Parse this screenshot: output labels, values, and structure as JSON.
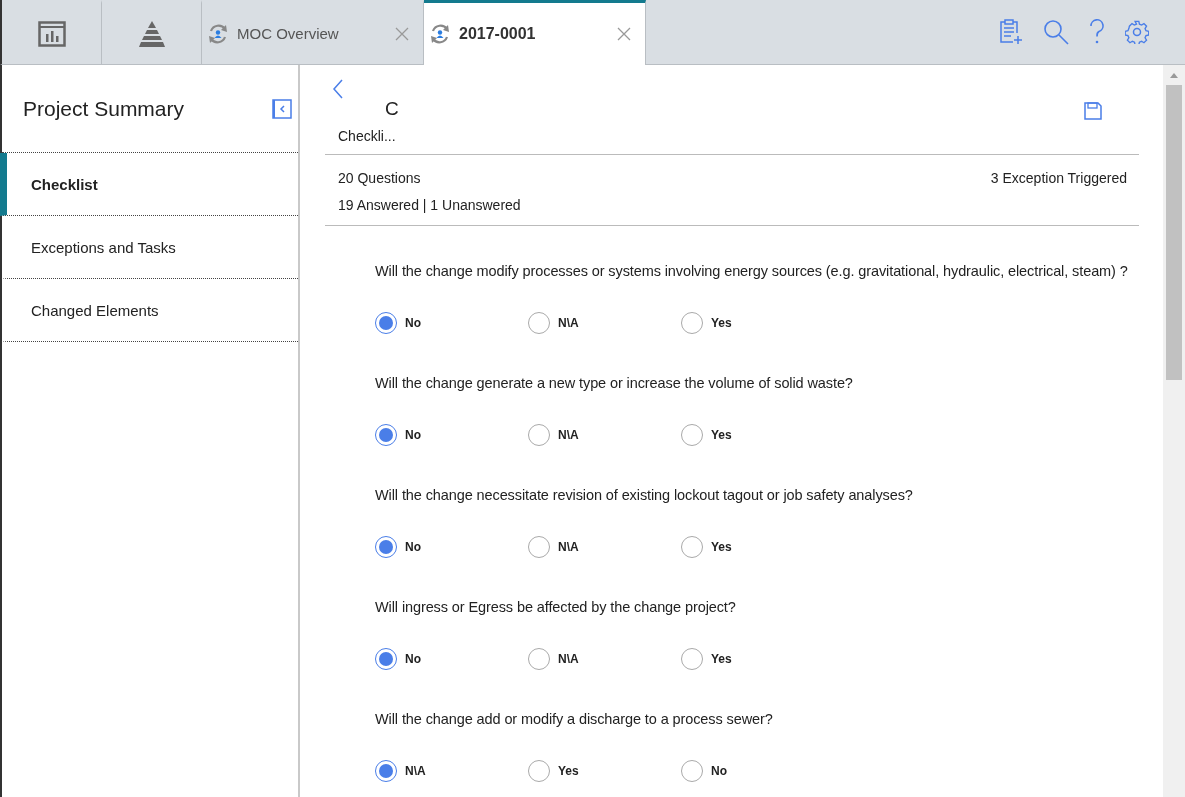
{
  "tabs": [
    {
      "kind": "report",
      "selected": false
    },
    {
      "kind": "pyramid",
      "selected": false
    },
    {
      "kind": "document",
      "label": "MOC Overview",
      "selected": false
    },
    {
      "kind": "document",
      "label": "2017-0001",
      "selected": true
    }
  ],
  "sidebar": {
    "title": "Project Summary",
    "items": [
      {
        "label": "Checklist",
        "selected": true
      },
      {
        "label": "Exceptions and Tasks",
        "selected": false
      },
      {
        "label": "Changed Elements",
        "selected": false
      }
    ]
  },
  "header": {
    "title": "C",
    "subtitle": "Checkli...",
    "questions_count": "20 Questions",
    "answered": "19 Answered | 1 Unanswered",
    "exceptions": "3 Exception Triggered"
  },
  "questions": [
    {
      "text": "Will the change modify processes or systems involving energy sources (e.g. gravitational, hydraulic, electrical, steam) ?",
      "options": [
        {
          "label": "No",
          "selected": true
        },
        {
          "label": "N\\A",
          "selected": false
        },
        {
          "label": "Yes",
          "selected": false
        }
      ]
    },
    {
      "text": "Will the change generate a new type or increase the volume of solid waste?",
      "options": [
        {
          "label": "No",
          "selected": true
        },
        {
          "label": "N\\A",
          "selected": false
        },
        {
          "label": "Yes",
          "selected": false
        }
      ]
    },
    {
      "text": "Will the change necessitate revision of existing lockout tagout or job safety analyses?",
      "options": [
        {
          "label": "No",
          "selected": true
        },
        {
          "label": "N\\A",
          "selected": false
        },
        {
          "label": "Yes",
          "selected": false
        }
      ]
    },
    {
      "text": "Will ingress or Egress be affected by the change project?",
      "options": [
        {
          "label": "No",
          "selected": true
        },
        {
          "label": "N\\A",
          "selected": false
        },
        {
          "label": "Yes",
          "selected": false
        }
      ]
    },
    {
      "text": "Will the change add or modify a discharge to a process sewer?",
      "options": [
        {
          "label": "N\\A",
          "selected": true
        },
        {
          "label": "Yes",
          "selected": false
        },
        {
          "label": "No",
          "selected": false
        }
      ]
    }
  ]
}
